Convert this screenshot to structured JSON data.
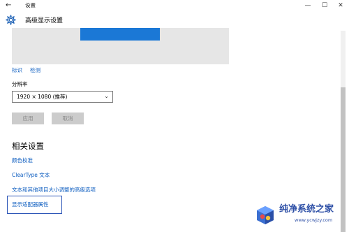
{
  "window": {
    "back_glyph": "←",
    "title": "设置",
    "min_glyph": "—",
    "max_glyph": "☐",
    "close_glyph": "✕"
  },
  "header": {
    "icon": "gear-icon",
    "title": "高级显示设置"
  },
  "display": {
    "identify_label": "标识",
    "detect_label": "检测",
    "monitor_color": "#1b78d6"
  },
  "resolution": {
    "label": "分辨率",
    "value": "1920 × 1080 (推荐)"
  },
  "actions": {
    "apply_label": "应用",
    "cancel_label": "取消"
  },
  "related": {
    "heading": "相关设置",
    "links": [
      "颜色校准",
      "ClearType 文本",
      "文本和其他项目大小调整的高级选项",
      "显示适配器属性"
    ]
  },
  "watermark": {
    "line1": "纯净系统之家",
    "line2": "www.ycwjzy.com"
  },
  "colors": {
    "accent": "#1b78d6",
    "link": "#0a5bbf",
    "highlight": "#2e57b8"
  }
}
